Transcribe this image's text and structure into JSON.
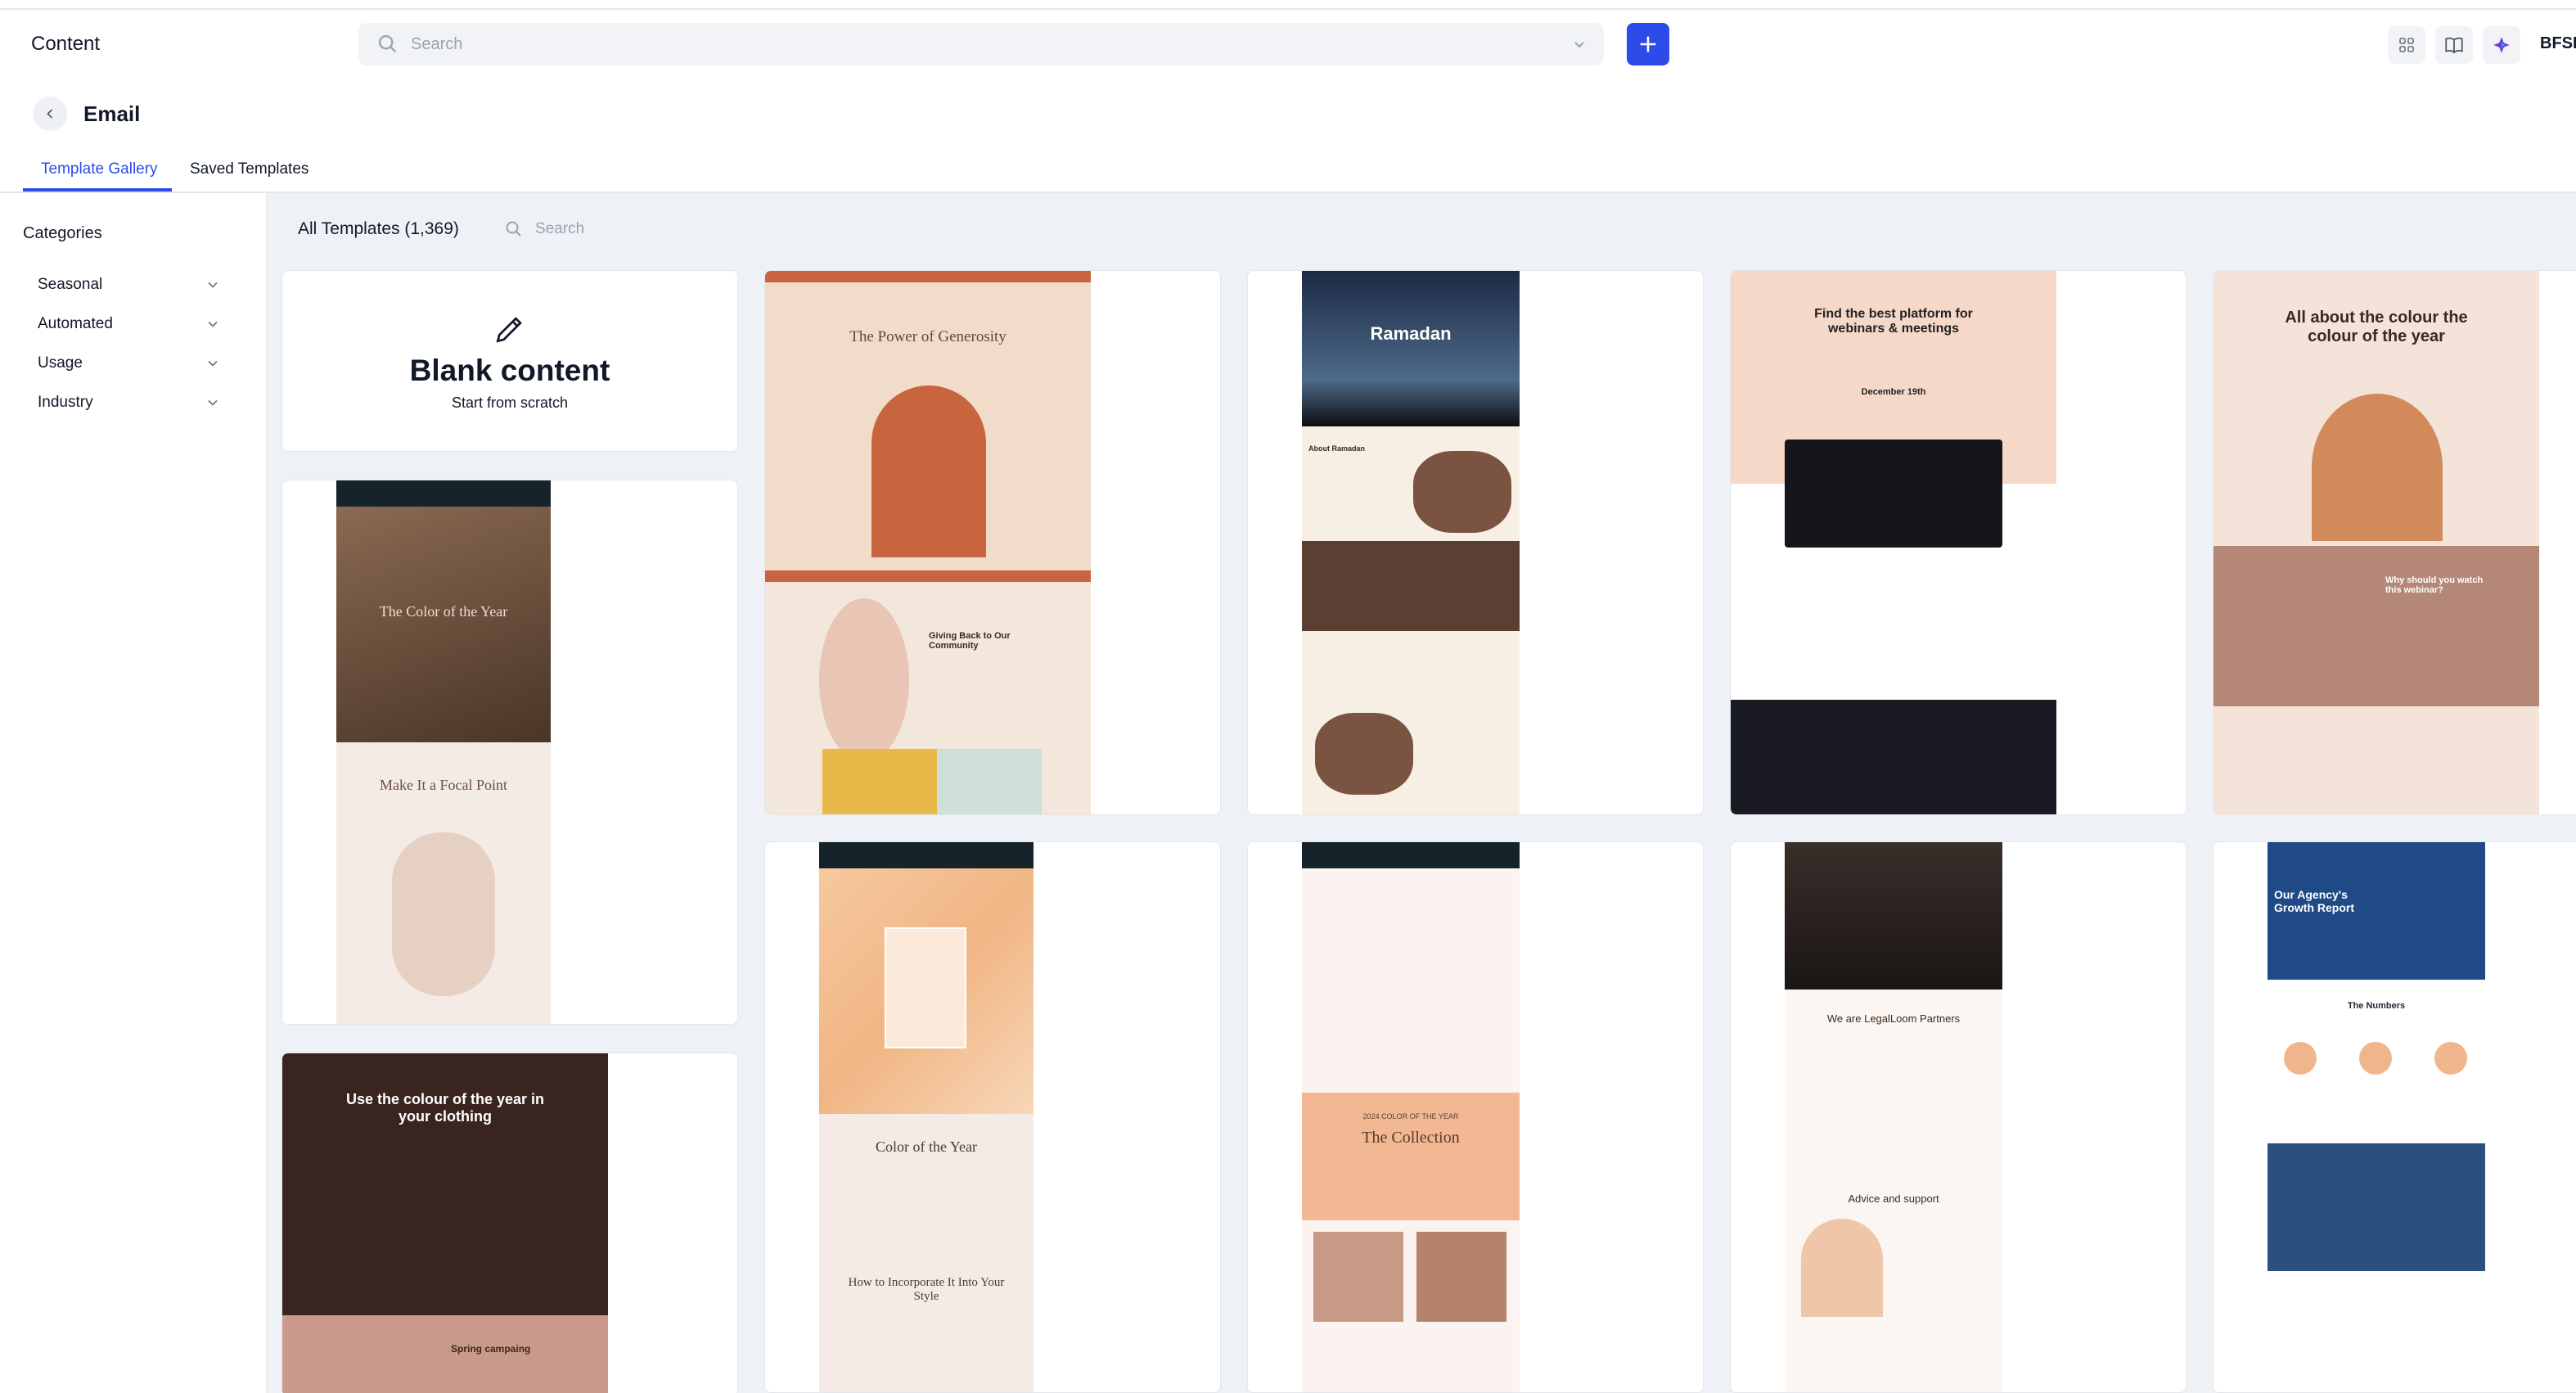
{
  "header": {
    "app_title": "Content",
    "search_placeholder": "Search",
    "org_label": "BFSI"
  },
  "page": {
    "title": "Email",
    "tabs": [
      {
        "label": "Template Gallery",
        "active": true
      },
      {
        "label": "Saved Templates",
        "active": false
      }
    ]
  },
  "sidebar": {
    "title": "Categories",
    "items": [
      {
        "label": "Seasonal"
      },
      {
        "label": "Automated"
      },
      {
        "label": "Usage"
      },
      {
        "label": "Industry"
      }
    ]
  },
  "main": {
    "heading": "All Templates (1,369)",
    "search_placeholder": "Search",
    "blank": {
      "title": "Blank content",
      "subtitle": "Start from scratch"
    },
    "templates": [
      {
        "headline": "The Power of Generosity",
        "caption": "Giving Back to Our Community"
      },
      {
        "headline": "Ramadan",
        "caption": "About Ramadan"
      },
      {
        "headline": "Find the best platform for webinars & meetings",
        "caption": "December 19th"
      },
      {
        "headline": "All about the colour the colour of the year",
        "caption": "Why should you watch this webinar?"
      },
      {
        "headline": "The Color of the Year",
        "caption": "Make It a Focal Point"
      },
      {
        "headline": "Color of the Year",
        "caption": "How to Incorporate It Into Your Style"
      },
      {
        "headline": "The Collection",
        "caption": "2024 COLOR OF THE YEAR"
      },
      {
        "headline": "We are LegalLoom Partners",
        "caption": "Advice and support"
      },
      {
        "headline": "Our Agency's Growth Report",
        "caption": "The Numbers"
      },
      {
        "headline": "Use the colour of the year in your clothing",
        "caption": "Spring campaing"
      }
    ]
  },
  "colors": {
    "accent": "#2d4be8",
    "background": "#eef1f5"
  }
}
